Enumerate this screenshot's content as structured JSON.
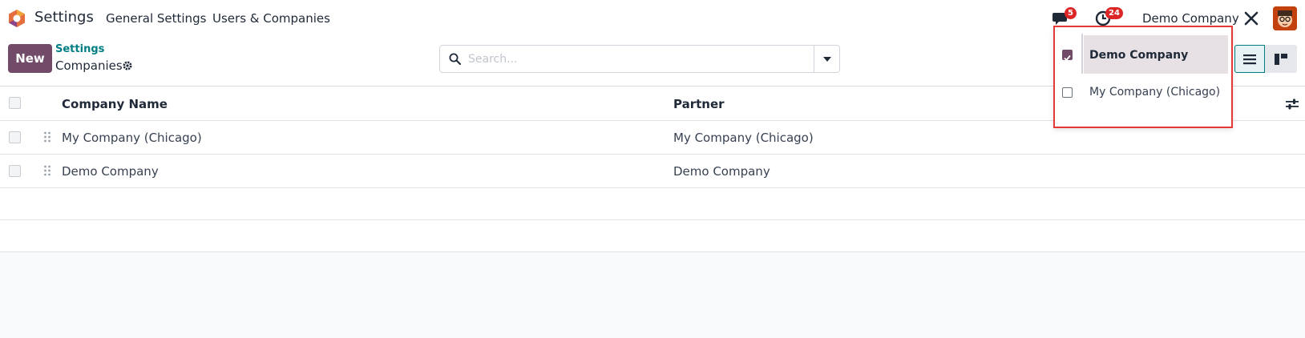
{
  "navbar": {
    "app_name": "Settings",
    "menu": [
      "General Settings",
      "Users & Companies"
    ],
    "messages_count": "5",
    "activities_count": "24",
    "current_company": "Demo Company",
    "brand_color": "#714b67"
  },
  "control_panel": {
    "new_label": "New",
    "breadcrumb_parent": "Settings",
    "breadcrumb_current": "Companies",
    "search_placeholder": "Search..."
  },
  "list": {
    "columns": [
      "Company Name",
      "Partner"
    ],
    "rows": [
      {
        "company_name": "My Company (Chicago)",
        "partner": "My Company (Chicago)"
      },
      {
        "company_name": "Demo Company",
        "partner": "Demo Company"
      }
    ]
  },
  "company_dropdown": {
    "items": [
      {
        "label": "Demo Company",
        "checked": true
      },
      {
        "label": "My Company (Chicago)",
        "checked": false
      }
    ]
  }
}
